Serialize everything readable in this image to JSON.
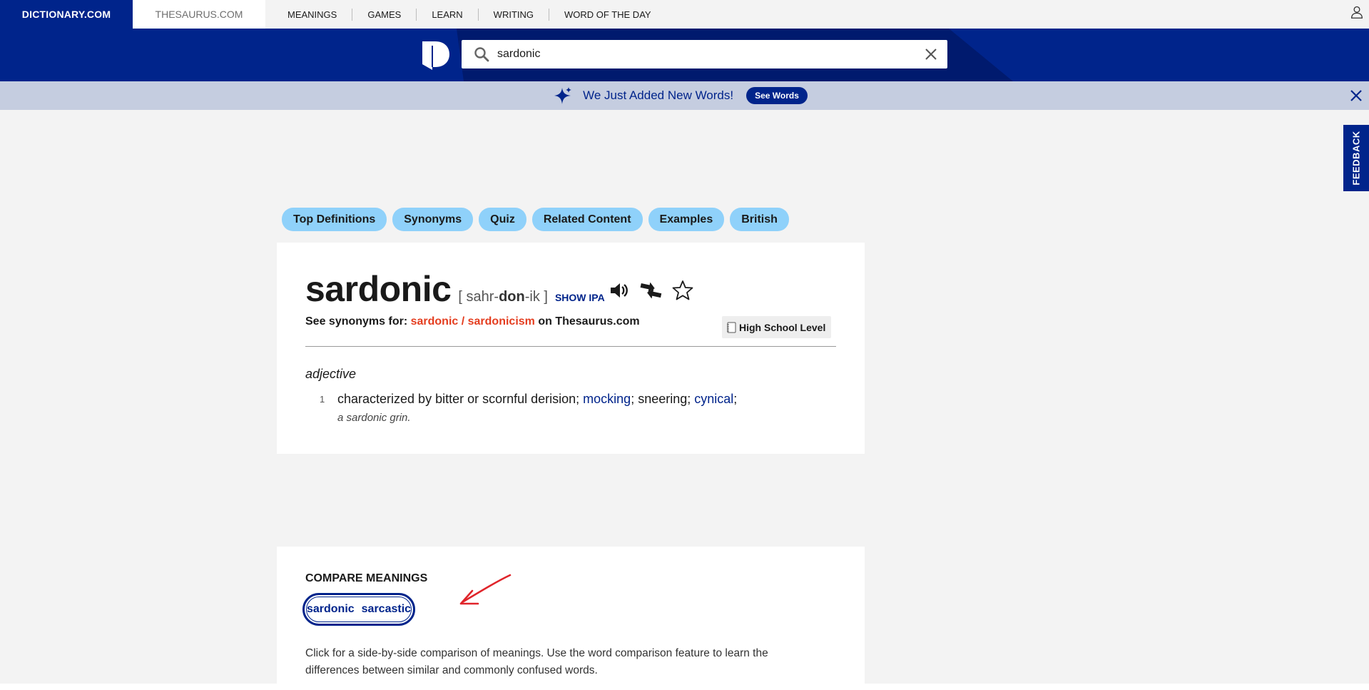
{
  "topnav": {
    "brand": "DICTIONARY.COM",
    "thesaurus": "THESAURUS.COM",
    "links": [
      "MEANINGS",
      "GAMES",
      "LEARN",
      "WRITING",
      "WORD OF THE DAY"
    ]
  },
  "search": {
    "value": "sardonic",
    "placeholder": ""
  },
  "banner": {
    "text": "We Just Added New Words!",
    "button": "See Words"
  },
  "feedback": "FEEDBACK",
  "pills": [
    "Top Definitions",
    "Synonyms",
    "Quiz",
    "Related Content",
    "Examples",
    "British"
  ],
  "entry": {
    "headword": "sardonic",
    "pron_open": "[ sahr-",
    "pron_stress": "don",
    "pron_close": "-ik ]",
    "show_ipa": "SHOW IPA",
    "syn_prefix": "See synonyms for: ",
    "syn_link": "sardonic / sardonicism",
    "syn_suffix": " on Thesaurus.com",
    "level": "High School Level",
    "pos": "adjective",
    "def_number": "1",
    "def_text_1": "characterized by bitter or scornful derision; ",
    "def_link_1": "mocking",
    "def_text_2": "; sneering; ",
    "def_link_2": "cynical",
    "def_text_3": ";",
    "example": "a sardonic grin."
  },
  "compare": {
    "title": "COMPARE MEANINGS",
    "word1": "sardonic",
    "word2": "sarcastic",
    "description": "Click for a side-by-side comparison of meanings. Use the word comparison feature to learn the differences between similar and commonly confused words."
  },
  "colors": {
    "brand_blue": "#00248b",
    "pill_blue": "#8fd1fa",
    "synonym_red": "#e43d1f",
    "banner_bg": "#c5cde0"
  }
}
